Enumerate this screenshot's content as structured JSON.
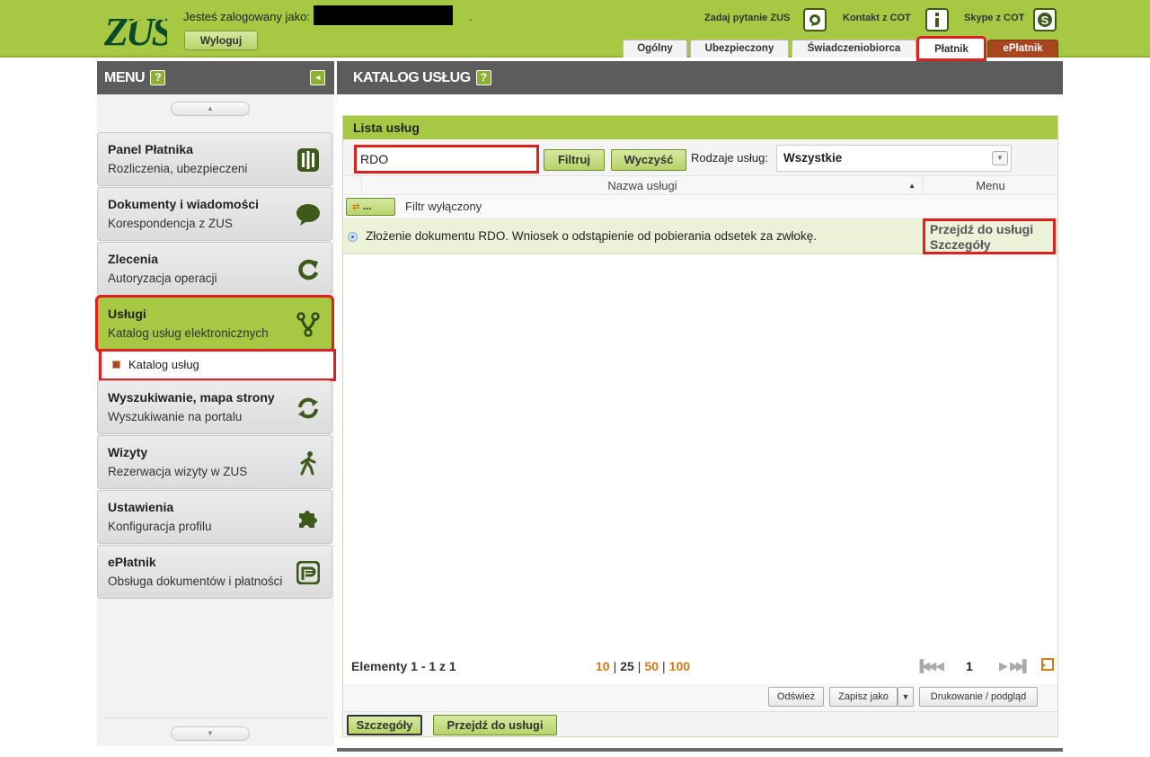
{
  "header": {
    "logo_text": "ZUS",
    "logged_in_label": "Jesteś zalogowany jako:",
    "user_suffix": ".",
    "logout_label": "Wyloguj",
    "links": [
      {
        "label": "Zadaj pytanie ZUS",
        "icon": "question-bubble-icon"
      },
      {
        "label": "Kontakt z COT",
        "icon": "info-icon"
      },
      {
        "label": "Skype z COT",
        "icon": "skype-icon"
      }
    ],
    "tabs": [
      {
        "label": "Ogólny"
      },
      {
        "label": "Ubezpieczony"
      },
      {
        "label": "Świadczeniobiorca"
      },
      {
        "label": "Płatnik",
        "selected": true
      },
      {
        "label": "ePłatnik"
      }
    ]
  },
  "sidebar": {
    "title": "MENU",
    "help": "?",
    "collapse_icon": "◄",
    "items": [
      {
        "title": "Panel Płatnika",
        "subtitle": "Rozliczenia, ubezpieczeni",
        "icon": "panel-icon"
      },
      {
        "title": "Dokumenty i wiadomości",
        "subtitle": "Korespondencja z ZUS",
        "icon": "speech-bubble-icon"
      },
      {
        "title": "Zlecenia",
        "subtitle": "Autoryzacja operacji",
        "icon": "refresh-arrow-icon"
      },
      {
        "title": "Usługi",
        "subtitle": "Katalog usług elektronicznych",
        "icon": "fork-icon",
        "active": true
      },
      {
        "title": "Wyszukiwanie, mapa strony",
        "subtitle": "Wyszukiwanie na portalu",
        "icon": "sync-icon"
      },
      {
        "title": "Wizyty",
        "subtitle": "Rezerwacja wizyty w ZUS",
        "icon": "walking-person-icon"
      },
      {
        "title": "Ustawienia",
        "subtitle": "Konfiguracja profilu",
        "icon": "puzzle-icon"
      },
      {
        "title": "ePłatnik",
        "subtitle": "Obsługa dokumentów i płatności",
        "icon": "eplatnik-icon"
      }
    ],
    "submenu": {
      "label": "Katalog usług"
    }
  },
  "main": {
    "title": "KATALOG USŁUG",
    "help": "?",
    "panel_title": "Lista usług",
    "search_value": "RDO",
    "filter_button": "Filtruj",
    "clear_button": "Wyczyść",
    "service_types_label": "Rodzaje usług:",
    "service_types_value": "Wszystkie",
    "columns": {
      "name": "Nazwa usługi",
      "menu": "Menu"
    },
    "filter_toggle": "...",
    "filter_status": "Filtr wyłączony",
    "rows": [
      {
        "name": "Złożenie dokumentu RDO. Wniosek o odstąpienie od pobierania odsetek za zwłokę.",
        "actions": [
          "Przejdź do usługi",
          "Szczegóły"
        ]
      }
    ],
    "pager": {
      "elements": "Elementy 1 - 1 z 1",
      "page_sizes": [
        "10",
        "25",
        "50",
        "100"
      ],
      "selected_page_size": "25",
      "current_page": "1"
    },
    "toolbar": {
      "refresh": "Odśwież",
      "save_as": "Zapisz jako",
      "print": "Drukowanie / podgląd"
    },
    "bottom": {
      "details": "Szczegóły",
      "goto": "Przejdź do usługi"
    }
  },
  "colors": {
    "green": "#a7c843",
    "dark_header": "#5c5c5c",
    "highlight_red": "#e02020",
    "eplatnik_brown": "#a8471f",
    "orange": "#d07a1a"
  }
}
